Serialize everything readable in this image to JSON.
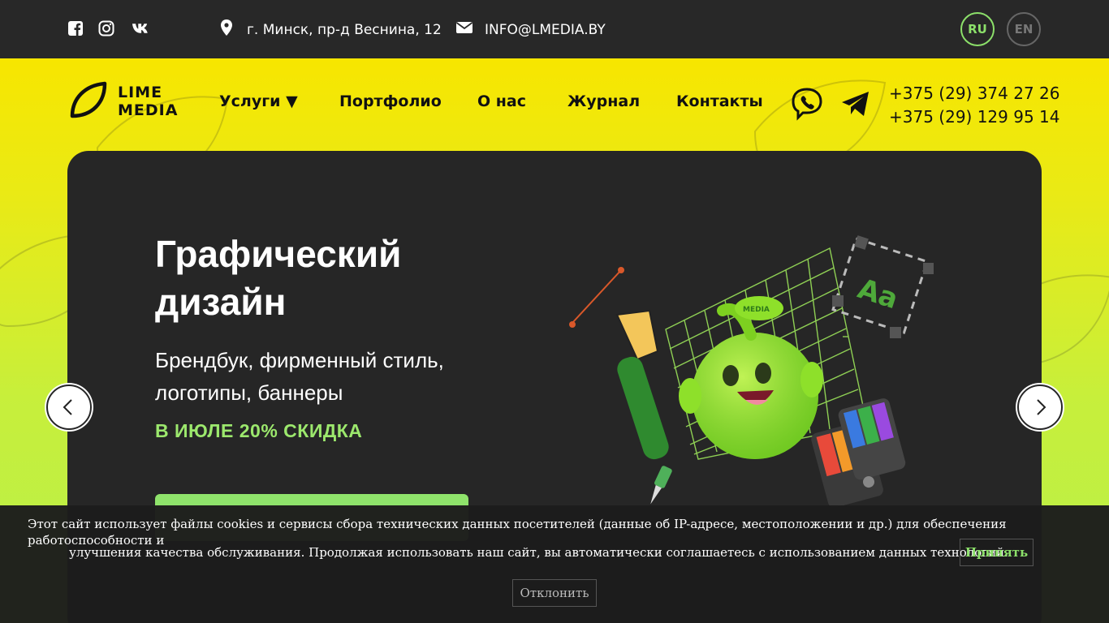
{
  "topbar": {
    "social": [
      {
        "icon": "facebook-icon"
      },
      {
        "icon": "instagram-icon"
      },
      {
        "icon": "vk-icon"
      }
    ],
    "address": "г. Минск, пр-д Веснина, 12",
    "email": "INFO@LMEDIA.BY",
    "languages": [
      "RU",
      "EN"
    ],
    "active_language": "RU"
  },
  "header": {
    "logo_line1": "LIME",
    "logo_line2": "MEDIA",
    "nav": [
      "Услуги ▼",
      "Портфолио",
      "О нас",
      "Журнал",
      "Контакты"
    ],
    "phone1": "+375 (29) 374 27 26",
    "phone2": "+375 (29) 129 95 14"
  },
  "hero": {
    "title": "Графический дизайн",
    "subtitle": "Брендбук, фирменный стиль, логотипы, баннеры",
    "promo": "В ИЮЛЕ 20% СКИДКА",
    "illustration_badge": "MEDIA",
    "illustration_glyph": "Aa"
  },
  "cookie": {
    "text_line1": "Этот сайт использует файлы cookies и сервисы сбора технических данных посетителей (данные об IP-адресе, местоположении и др.) для обеспечения работоспособности и",
    "text_line2": "улучшения качества обслуживания. Продолжая использовать наш сайт, вы автоматически соглашаетесь с использованием данных технологий.",
    "accept_label": "Принять",
    "decline_label": "Отклонить"
  },
  "colors": {
    "topbar_bg": "#282828",
    "accent_green": "#8ce06a",
    "hero_bg": "#262626",
    "header_yellow": "#f7e600"
  }
}
